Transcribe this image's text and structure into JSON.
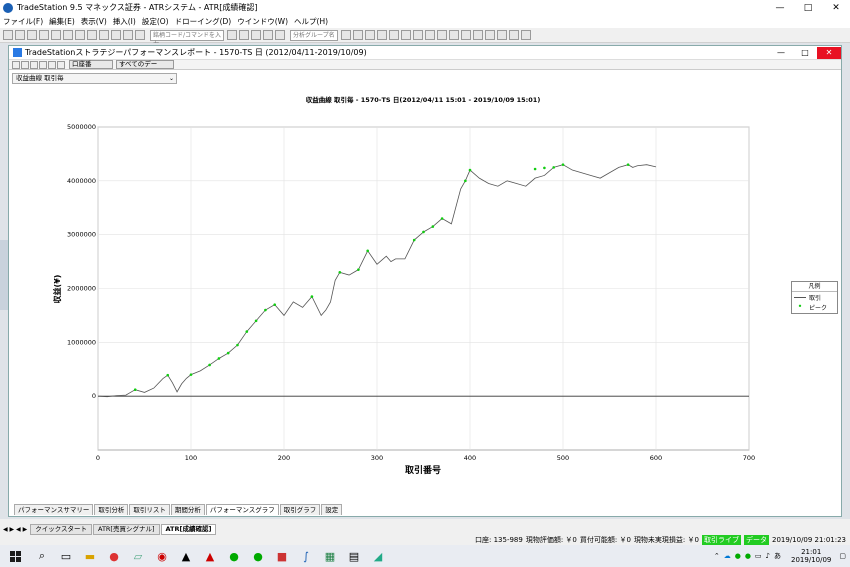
{
  "app": {
    "title": "TradeStation 9.5 マネックス証券 - ATRシステム - ATR[成績確認]",
    "window_controls": {
      "minimize": "—",
      "maximize": "□",
      "close": "✕"
    }
  },
  "menu": [
    "ファイル(F)",
    "編集(E)",
    "表示(V)",
    "挿入(I)",
    "設定(O)",
    "ドローイング(D)",
    "ウインドウ(W)",
    "ヘルプ(H)"
  ],
  "toolbar": {
    "symbol_placeholder": "銘柄コード/コマンドを入力",
    "analysis_placeholder": "分析グループ名"
  },
  "document": {
    "title": "TradeStationストラテジーパフォーマンスレポート - 1570-TS 日 (2012/04/11-2019/10/09)",
    "account_dropdown": "口座番",
    "data_dropdown": "すべてのデー",
    "curve_dropdown": "収益曲線 取引毎"
  },
  "report_tabs": [
    "パフォーマンスサマリー",
    "取引分析",
    "取引リスト",
    "期間分析",
    "パフォーマンスグラフ",
    "取引グラフ",
    "設定"
  ],
  "active_report_tab": 4,
  "window_tabs": [
    "クイックスタート",
    "ATR[売買シグナル]",
    "ATR[成績確認]"
  ],
  "active_window_tab": 2,
  "window_tab_nav": "◀ ▶ ◀ ▶",
  "status": {
    "account": "口座: 135-989",
    "valuation": "現物評価額: ￥0",
    "buying_power": "買付可能額: ￥0",
    "unrealized": "現物未実現損益: ￥0",
    "live": "取引ライブ",
    "data": "データ",
    "datetime": "2019/10/09 21:01:23"
  },
  "taskbar": {
    "time": "21:01",
    "date": "2019/10/09",
    "ime": "あ"
  },
  "legend": {
    "title": "凡例",
    "items": [
      "取引",
      "ピーク"
    ]
  },
  "colors": {
    "line": "#555555",
    "peak": "#11cc11"
  },
  "chart_data": {
    "type": "line",
    "title": "収益曲線 取引毎 - 1570-TS 日(2012/04/11 15:01 - 2019/10/09 15:01)",
    "xlabel": "取引番号",
    "ylabel": "収益(¥)",
    "xlim": [
      0,
      700
    ],
    "ylim": [
      -1000000,
      5000000
    ],
    "xticks": [
      0,
      100,
      200,
      300,
      400,
      500,
      600,
      700
    ],
    "yticks": [
      0,
      1000000,
      2000000,
      3000000,
      4000000,
      5000000
    ],
    "ytick_labels": [
      "0",
      "1000000",
      "2000000",
      "3000000",
      "4000000",
      "5000000"
    ],
    "grid": true,
    "legend": "right",
    "series": [
      {
        "name": "取引",
        "x": [
          0,
          10,
          20,
          30,
          40,
          50,
          60,
          70,
          75,
          80,
          85,
          90,
          95,
          100,
          110,
          120,
          130,
          140,
          150,
          160,
          170,
          180,
          190,
          200,
          210,
          220,
          230,
          240,
          245,
          250,
          255,
          260,
          270,
          280,
          290,
          300,
          310,
          315,
          320,
          330,
          340,
          350,
          360,
          370,
          380,
          390,
          395,
          400,
          410,
          420,
          430,
          440,
          450,
          460,
          470,
          480,
          490,
          500,
          510,
          520,
          530,
          540,
          550,
          560,
          570,
          575,
          580,
          590,
          600
        ],
        "y": [
          0,
          -10000,
          10000,
          20000,
          120000,
          70000,
          150000,
          330000,
          390000,
          250000,
          80000,
          230000,
          330000,
          400000,
          470000,
          580000,
          700000,
          800000,
          950000,
          1200000,
          1400000,
          1600000,
          1700000,
          1500000,
          1750000,
          1650000,
          1850000,
          1500000,
          1600000,
          1750000,
          2150000,
          2300000,
          2250000,
          2350000,
          2700000,
          2450000,
          2600000,
          2500000,
          2550000,
          2550000,
          2900000,
          3050000,
          3150000,
          3300000,
          3200000,
          3850000,
          4000000,
          4200000,
          4050000,
          3950000,
          3900000,
          4000000,
          3950000,
          3900000,
          4050000,
          4100000,
          4250000,
          4300000,
          4200000,
          4150000,
          4100000,
          4050000,
          4150000,
          4250000,
          4300000,
          4250000,
          4280000,
          4300000,
          4260000
        ]
      },
      {
        "name": "ピーク",
        "x": [
          40,
          75,
          100,
          120,
          130,
          140,
          150,
          160,
          170,
          180,
          190,
          230,
          260,
          280,
          290,
          340,
          350,
          360,
          370,
          395,
          400,
          470,
          480,
          490,
          500,
          570
        ],
        "y": [
          120000,
          390000,
          400000,
          580000,
          700000,
          800000,
          950000,
          1200000,
          1400000,
          1600000,
          1700000,
          1850000,
          2300000,
          2350000,
          2700000,
          2900000,
          3050000,
          3150000,
          3300000,
          4000000,
          4200000,
          4220000,
          4240000,
          4250000,
          4300000,
          4300000
        ]
      }
    ]
  }
}
